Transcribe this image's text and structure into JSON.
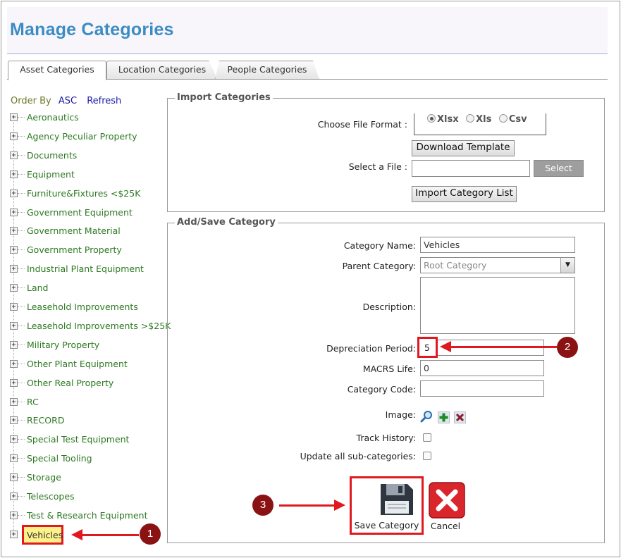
{
  "page": {
    "title": "Manage Categories"
  },
  "tabs": [
    {
      "label": "Asset Categories"
    },
    {
      "label": "Location Categories"
    },
    {
      "label": "People Categories"
    }
  ],
  "order": {
    "label": "Order By",
    "asc": "ASC",
    "refresh": "Refresh"
  },
  "tree": {
    "items": [
      "Aeronautics",
      "Agency Peculiar Property",
      "Documents",
      "Equipment",
      "Furniture&Fixtures <$25K",
      "Government Equipment",
      "Government Material",
      "Government Property",
      "Industrial Plant Equipment",
      "Land",
      "Leasehold Improvements",
      "Leasehold Improvements >$25K",
      "Military Property",
      "Other Plant Equipment",
      "Other Real Property",
      "RC",
      "RECORD",
      "Special Test Equipment",
      "Special Tooling",
      "Storage",
      "Telescopes",
      "Test & Research Equipment"
    ],
    "selected": "Vehicles"
  },
  "import": {
    "legend": "Import Categories",
    "format_label": "Choose File Format :",
    "formats": [
      "Xlsx",
      "Xls",
      "Csv"
    ],
    "download_btn": "Download Template",
    "file_label": "Select a File :",
    "select_btn": "Select",
    "import_btn": "Import Category List"
  },
  "form": {
    "legend": "Add/Save Category",
    "name_label": "Category Name:",
    "name_value": "Vehicles",
    "parent_label": "Parent Category:",
    "parent_value": "Root Category",
    "desc_label": "Description:",
    "dep_label": "Depreciation Period:",
    "dep_value": "5",
    "macrs_label": "MACRS Life:",
    "macrs_value": "0",
    "code_label": "Category Code:",
    "code_value": "",
    "image_label": "Image:",
    "track_label": "Track History:",
    "update_label": "Update all sub-categories:",
    "save_label": "Save Category",
    "cancel_label": "Cancel"
  },
  "annotations": {
    "one": "1",
    "two": "2",
    "three": "3"
  },
  "colors": {
    "title": "#3c8cc4",
    "tree_text": "#2d7a22",
    "highlight": "#e0191f",
    "annotation": "#8b1212"
  }
}
